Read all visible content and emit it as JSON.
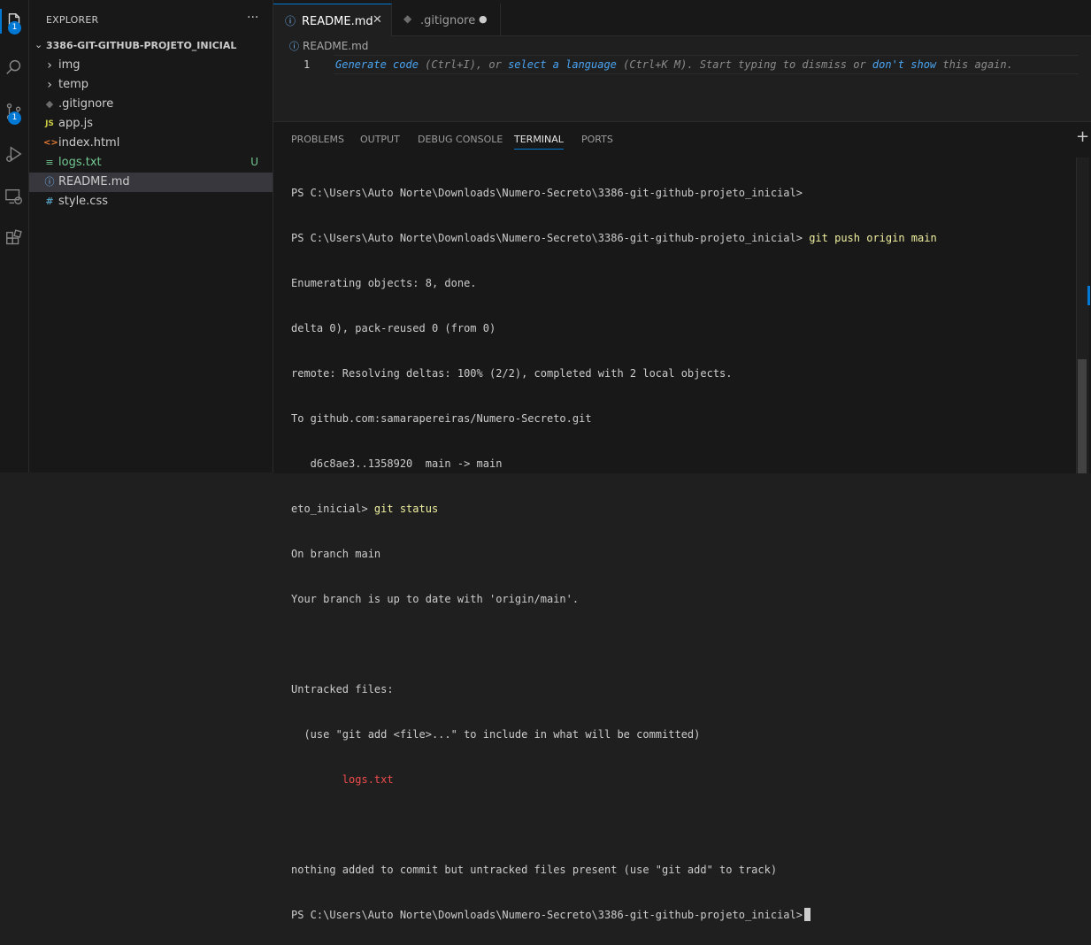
{
  "activity_bar": {
    "explorer_badge": "1",
    "source_control_badge": "1"
  },
  "sidebar": {
    "title": "EXPLORER",
    "more": "···",
    "folder": "3386-GIT-GITHUB-PROJETO_INICIAL",
    "items": [
      {
        "label": "img",
        "icon": "›"
      },
      {
        "label": "temp",
        "icon": "›"
      },
      {
        "label": ".gitignore",
        "icon": "◆"
      },
      {
        "label": "app.js",
        "icon": "JS"
      },
      {
        "label": "index.html",
        "icon": "<>"
      },
      {
        "label": "logs.txt",
        "icon": "≡",
        "badge": "U"
      },
      {
        "label": "README.md",
        "icon": "ⓘ"
      },
      {
        "label": "style.css",
        "icon": "#"
      }
    ]
  },
  "editor": {
    "tabs": [
      {
        "label": "README.md",
        "icon": "ⓘ",
        "close": "✕"
      },
      {
        "label": ".gitignore",
        "icon": "◆",
        "close": "●"
      }
    ],
    "breadcrumb": "README.md",
    "breadcrumb_icon": "ⓘ",
    "line_number": "1",
    "hint": {
      "link1": "Generate code",
      "text1": " (Ctrl+I), or ",
      "link2": "select a language",
      "text2": " (Ctrl+K M). Start typing to dismiss or ",
      "link3": "don't show",
      "text3": " this again."
    }
  },
  "panel": {
    "tabs": [
      "PROBLEMS",
      "OUTPUT",
      "DEBUG CONSOLE",
      "TERMINAL",
      "PORTS"
    ],
    "add": "+",
    "terminal": {
      "line1": "PS C:\\Users\\Auto Norte\\Downloads\\Numero-Secreto\\3386-git-github-projeto_inicial>",
      "line2_prompt": "PS C:\\Users\\Auto Norte\\Downloads\\Numero-Secreto\\3386-git-github-projeto_inicial> ",
      "line2_cmd": "git push origin main",
      "line3": "Enumerating objects: 8, done.",
      "line4": "delta 0), pack-reused 0 (from 0)",
      "line5": "remote: Resolving deltas: 100% (2/2), completed with 2 local objects.",
      "line6": "To github.com:samarapereiras/Numero-Secreto.git",
      "line7": "   d6c8ae3..1358920  main -> main",
      "line8_prompt": "eto_inicial> ",
      "line8_cmd": "git status",
      "line9": "On branch main",
      "line10": "Your branch is up to date with 'origin/main'.",
      "line12": "Untracked files:",
      "line13": "  (use \"git add <file>...\" to include in what will be committed)",
      "line14": "        logs.txt",
      "line16": "nothing added to commit but untracked files present (use \"git add\" to track)",
      "line17": "PS C:\\Users\\Auto Norte\\Downloads\\Numero-Secreto\\3386-git-github-projeto_inicial>"
    }
  },
  "colors": {
    "accent": "#0078d4",
    "untracked": "#73c991",
    "error": "#f14c4c",
    "command": "#f0f0a0"
  }
}
